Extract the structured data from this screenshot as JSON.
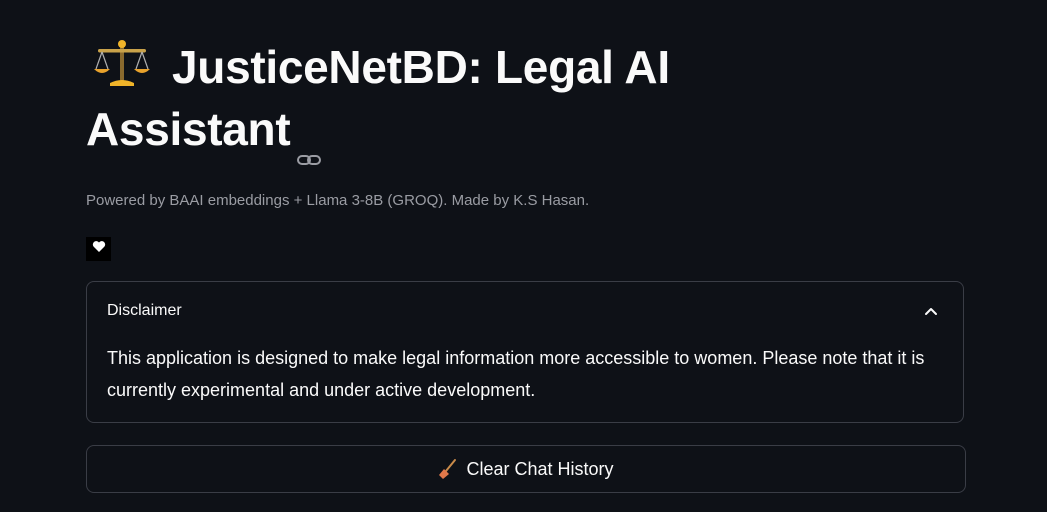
{
  "header": {
    "title": "JusticeNetBD: Legal AI Assistant",
    "title_icon": "balance-scale-emoji",
    "anchor_icon": "link-icon"
  },
  "caption": "Powered by BAAI embeddings + Llama 3-8B (GROQ). Made by K.S Hasan.",
  "badge": {
    "icon": "heart-icon"
  },
  "disclaimer": {
    "label": "Disclaimer",
    "expanded": true,
    "text": "This application is designed to make legal information more accessible to women. Please note that it is currently experimental and under active development."
  },
  "clear_button": {
    "label": "Clear Chat History",
    "icon": "broom-emoji"
  },
  "colors": {
    "background": "#0e1117",
    "text": "#fafafa",
    "muted_text": "#9a9ca3",
    "border": "#3a3d46"
  }
}
